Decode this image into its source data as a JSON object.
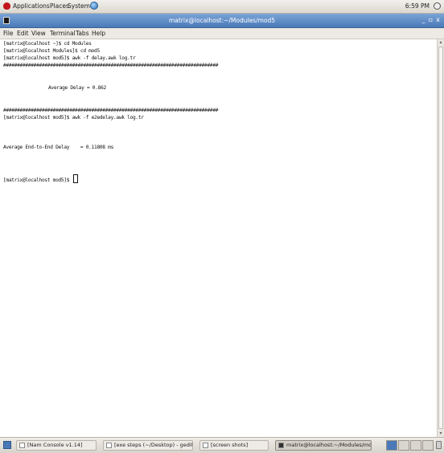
{
  "top_panel": {
    "menus": [
      "Applications",
      "Places",
      "System"
    ],
    "clock": "6:59 PM"
  },
  "window": {
    "title": "matrix@localhost:~/Modules/mod5",
    "controls": [
      "_",
      "▫",
      "x"
    ]
  },
  "menu_bar": [
    "File",
    "Edit",
    "View",
    "Terminal",
    "Tabs",
    "Help"
  ],
  "terminal": {
    "lines": [
      "[matrix@localhost ~]$ cd Modules",
      "[matrix@localhost Modules]$ cd mod5",
      "[matrix@localhost mod5]$ awk -f delay.awk log.tr",
      "##############################################################################",
      "Average Delay = 0.862",
      "##############################################################################",
      "[matrix@localhost mod5]$ awk -f e2edelay.awk log.tr",
      "Average End-to-End Delay    = 0.11808 ms",
      "[matrix@localhost mod5]$ "
    ]
  },
  "taskbar": {
    "tasks": [
      {
        "label": "[Nam Console v1.14]"
      },
      {
        "label": "[exe steps (~/Desktop) - gedit]"
      },
      {
        "label": "[screen shots]"
      },
      {
        "label": "matrix@localhost:~/Modules/mod5"
      }
    ]
  },
  "icons": {
    "distro": "fedora-icon",
    "web": "globe-icon",
    "volume": "volume-icon",
    "terminal": "terminal-icon",
    "trash": "trash-icon"
  },
  "colors": {
    "title_bar": "#4a79b8",
    "terminal_bg": "#ffffff",
    "terminal_fg": "#111111"
  }
}
